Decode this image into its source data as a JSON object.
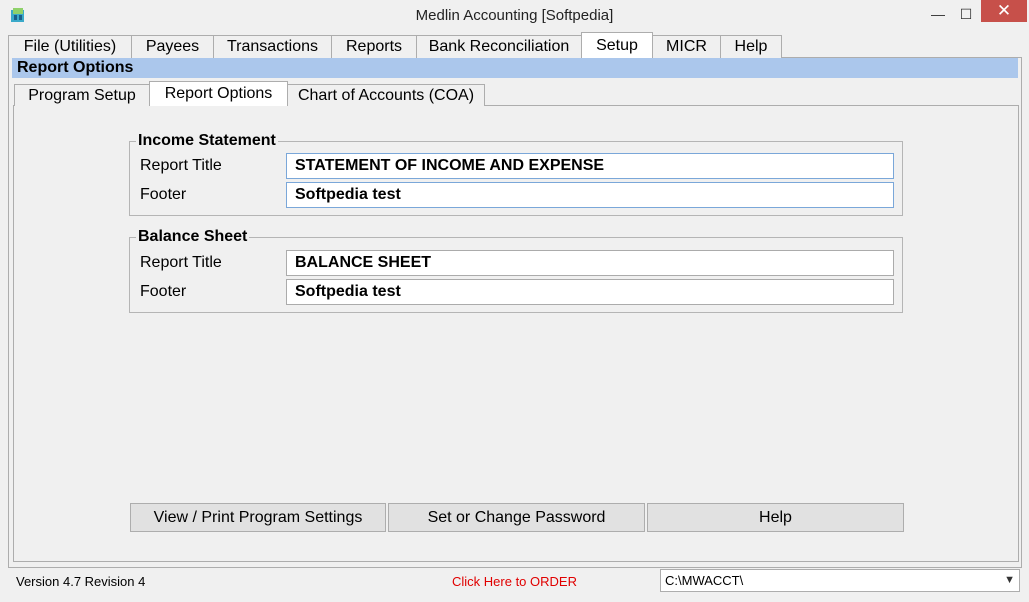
{
  "window": {
    "title": "Medlin Accounting [Softpedia]",
    "minimize_glyph": "—",
    "maximize_glyph": "☐",
    "close_glyph": "✕"
  },
  "main_tabs": [
    {
      "label": "File (Utilities)",
      "active": false
    },
    {
      "label": "Payees",
      "active": false
    },
    {
      "label": "Transactions",
      "active": false
    },
    {
      "label": "Reports",
      "active": false
    },
    {
      "label": "Bank Reconciliation",
      "active": false
    },
    {
      "label": "Setup",
      "active": true
    },
    {
      "label": "MICR",
      "active": false
    },
    {
      "label": "Help",
      "active": false
    }
  ],
  "section_header": "Report Options",
  "sub_tabs": [
    {
      "label": "Program Setup",
      "active": false
    },
    {
      "label": "Report Options",
      "active": true
    },
    {
      "label": "Chart of Accounts (COA)",
      "active": false
    }
  ],
  "income_statement": {
    "legend": "Income Statement",
    "report_title_label": "Report Title",
    "report_title_value": "STATEMENT OF INCOME AND EXPENSE",
    "footer_label": "Footer",
    "footer_value": "Softpedia test"
  },
  "balance_sheet": {
    "legend": "Balance Sheet",
    "report_title_label": "Report Title",
    "report_title_value": "BALANCE SHEET",
    "footer_label": "Footer",
    "footer_value": "Softpedia test"
  },
  "buttons": {
    "view_print": "View / Print Program Settings",
    "password": "Set or Change Password",
    "help": "Help"
  },
  "status": {
    "version": "Version 4.7 Revision 4",
    "order": "Click Here to ORDER",
    "path": "C:\\MWACCT\\"
  },
  "colors": {
    "header_bar": "#abc7ec",
    "order_link": "#e00000",
    "close_button": "#c7504a"
  }
}
